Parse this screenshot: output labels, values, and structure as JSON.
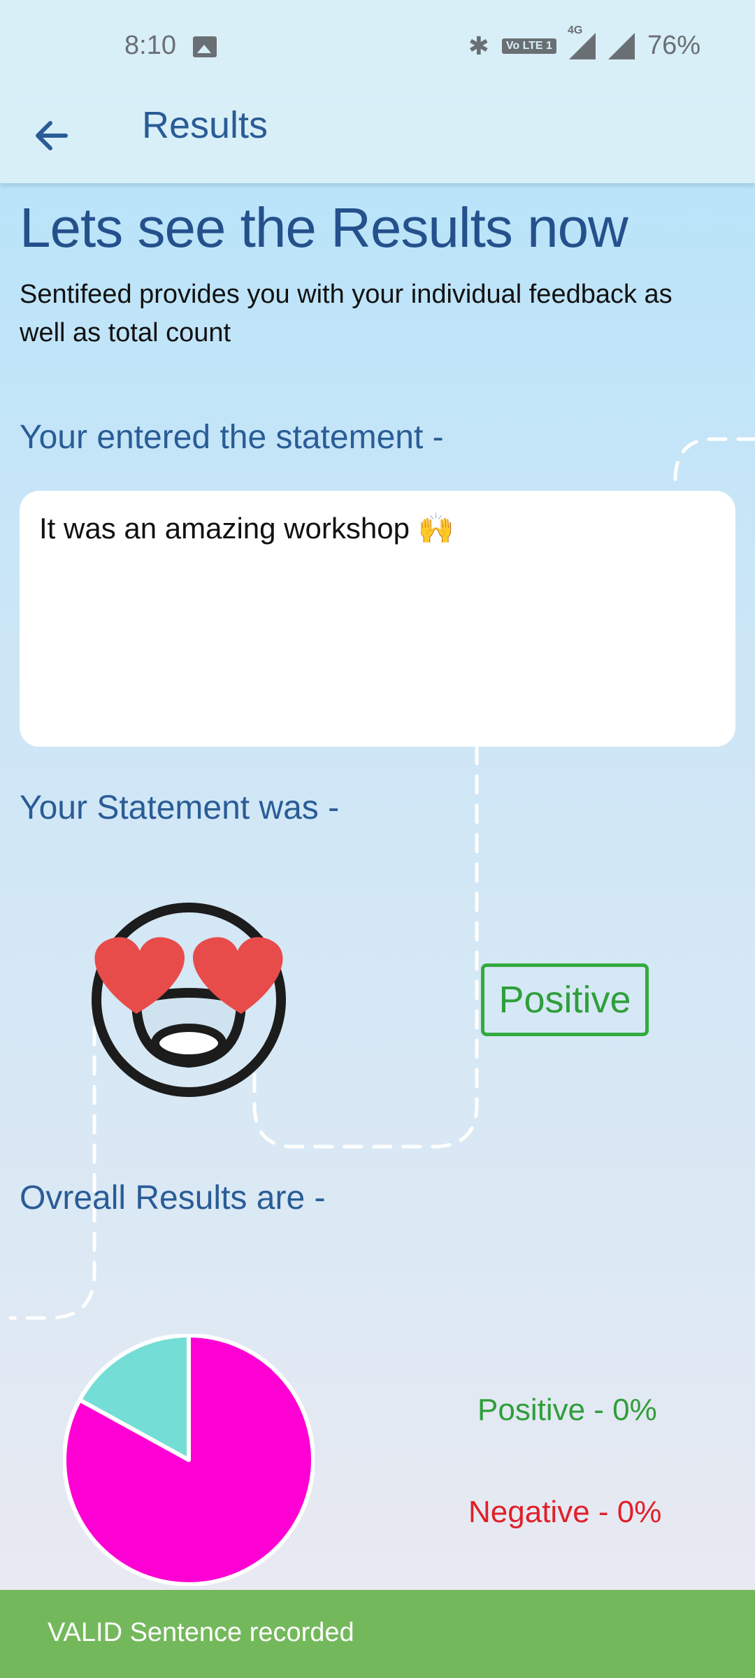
{
  "status_bar": {
    "time": "8:10",
    "network_label": "4G",
    "volte_label": "Vo LTE 1",
    "battery": "76%"
  },
  "app_bar": {
    "title": "Results"
  },
  "main": {
    "headline": "Lets see the Results now",
    "description": "Sentifeed provides you with your individual feedback as well as total count",
    "entered_label": "Your entered the statement -",
    "statement_text": "It was an amazing workshop 🙌",
    "statement_label": "Your Statement was -",
    "sentiment": "Positive",
    "overall_label": "Ovreall Results are -"
  },
  "results": {
    "positive_text": "Positive - 0%",
    "negative_text": "Negative - 0%"
  },
  "chart_data": {
    "type": "pie",
    "slices": [
      {
        "label": "Magenta slice",
        "value": 0.83,
        "color": "#ff00d4"
      },
      {
        "label": "Teal slice",
        "value": 0.17,
        "color": "#74ded6"
      }
    ]
  },
  "colors": {
    "accent": "#2a5c96",
    "positive": "#2f9e3a",
    "negative": "#e0202a",
    "snackbar": "#74b85c"
  },
  "snackbar": {
    "message": "VALID Sentence recorded"
  }
}
